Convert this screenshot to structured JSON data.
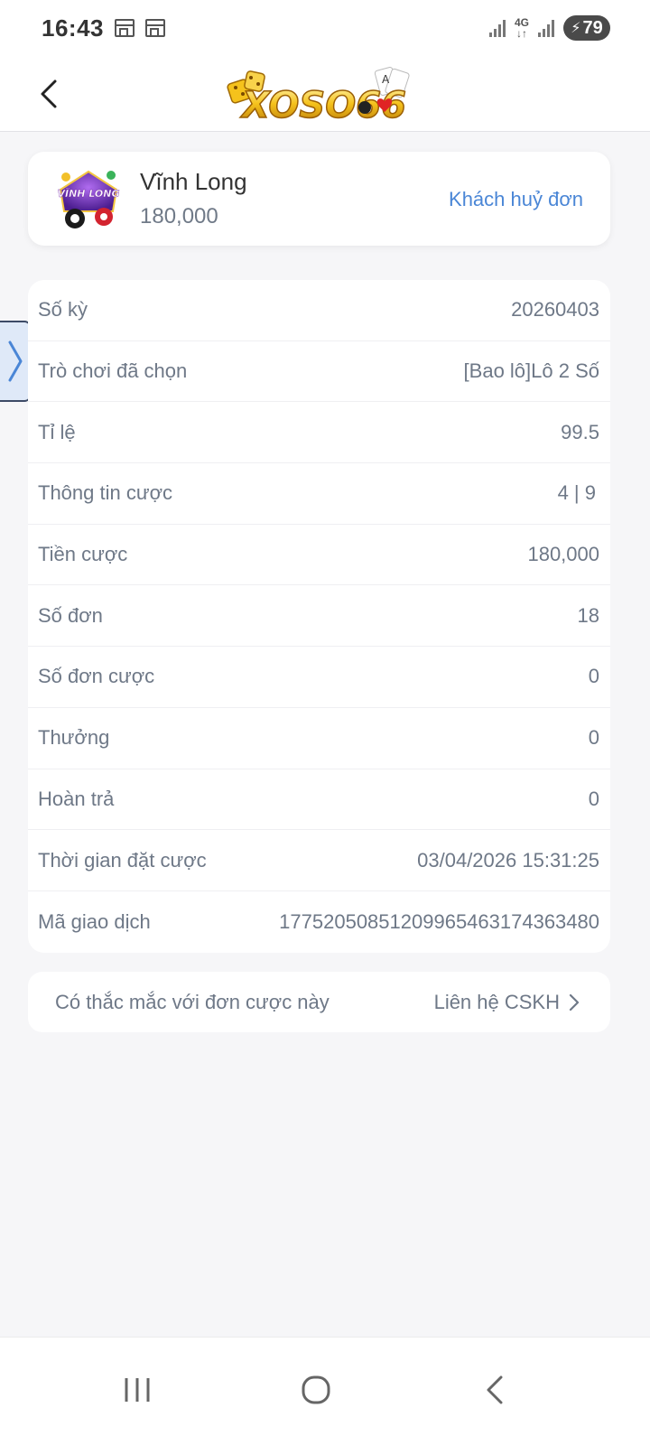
{
  "status_bar": {
    "time": "16:43",
    "network": "4G",
    "battery": "79",
    "icons": [
      "calendar-icon",
      "calendar-icon",
      "signal-icon",
      "signal-icon",
      "battery-charging-icon"
    ]
  },
  "header": {
    "logo_text": "XOSO66",
    "back_icon": "chevron-left-icon"
  },
  "game": {
    "thumb_text": "VĨNH LONG",
    "name": "Vĩnh Long",
    "amount": "180,000",
    "status": "Khách huỷ đơn"
  },
  "details": [
    {
      "label": "Số kỳ",
      "value": "20260403"
    },
    {
      "label": "Trò chơi đã chọn",
      "value": "[Bao lô]Lô 2 Số"
    },
    {
      "label": "Tỉ lệ",
      "value": "99.5"
    },
    {
      "label": "Thông tin cược",
      "value": "4 | 9"
    },
    {
      "label": "Tiền cược",
      "value": "180,000"
    },
    {
      "label": "Số đơn",
      "value": "18"
    },
    {
      "label": "Số đơn cược",
      "value": "0"
    },
    {
      "label": "Thưởng",
      "value": "0"
    },
    {
      "label": "Hoàn trả",
      "value": "0"
    },
    {
      "label": "Thời gian đặt cược",
      "value": "03/04/2026 15:31:25"
    },
    {
      "label": "Mã giao dịch",
      "value": "1775205085120996546317436348​0"
    }
  ],
  "help": {
    "question": "Có thắc mắc với đơn cược này",
    "link": "Liên hệ CSKH"
  },
  "colors": {
    "accent": "#4a86d6",
    "background": "#f6f6f8",
    "card": "#ffffff",
    "text": "#6e7887",
    "logo_gold": "#f2b418"
  }
}
